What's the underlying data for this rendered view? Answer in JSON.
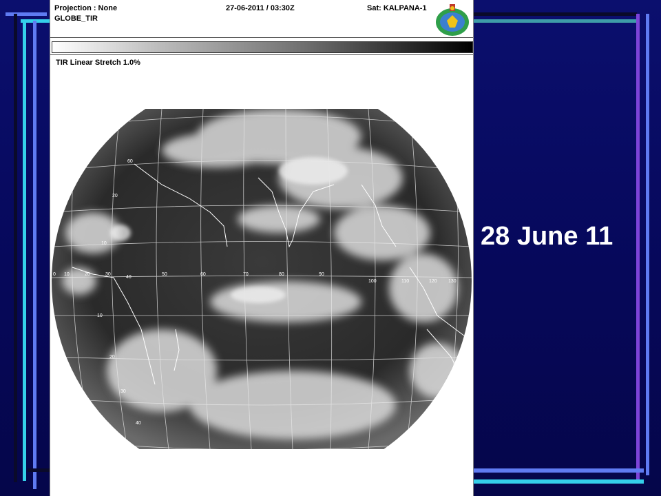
{
  "slide": {
    "date_label": "28 June 11",
    "accent_colors": {
      "blue": "#5f7bf2",
      "cyan": "#35d0ea",
      "purple": "#7d44d8",
      "background": "#06085a"
    }
  },
  "satellite_image": {
    "projection": "Projection : None",
    "product": "GLOBE_TIR",
    "datetime": "27-06-2011 / 03:30Z",
    "satellite": "Sat: KALPANA-1",
    "enhancement": "TIR Linear Stretch 1.0%",
    "logo_icon": "imd-emblem-icon",
    "grid_labels": {
      "latitudes": [
        "60",
        "20",
        "10",
        "0",
        "10",
        "20",
        "30",
        "40"
      ],
      "longitudes": [
        "0",
        "10",
        "20",
        "30",
        "40",
        "50",
        "60",
        "70",
        "80",
        "90",
        "100",
        "110",
        "120",
        "130"
      ]
    }
  }
}
